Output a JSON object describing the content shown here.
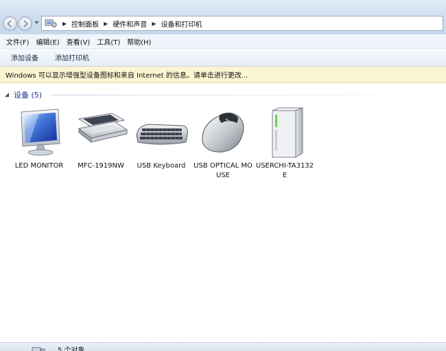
{
  "address": {
    "breadcrumbs": [
      "控制面板",
      "硬件和声音",
      "设备和打印机"
    ],
    "home_icon": "control-panel-icon"
  },
  "menu": {
    "items": [
      "文件(F)",
      "编辑(E)",
      "查看(V)",
      "工具(T)",
      "帮助(H)"
    ]
  },
  "commands": {
    "add_device": "添加设备",
    "add_printer": "添加打印机"
  },
  "infobar": {
    "text": "Windows 可以显示增强型设备图标和来自 Internet 的信息。请单击进行更改..."
  },
  "group": {
    "title": "设备 (5)"
  },
  "devices": [
    {
      "label": "LED MONITOR",
      "icon": "monitor-icon"
    },
    {
      "label": "MFC-1919NW",
      "icon": "scanner-icon"
    },
    {
      "label": "USB Keyboard",
      "icon": "keyboard-icon"
    },
    {
      "label": "USB OPTICAL MOUSE",
      "icon": "mouse-icon"
    },
    {
      "label": "USERCHI-TA3132E",
      "icon": "computer-tower-icon"
    }
  ],
  "status": {
    "text": "5 个对象"
  },
  "colors": {
    "group_title": "#1e3287",
    "infobar_bg": "#fbf5d2",
    "toolbar_bg": "#e6edf6"
  }
}
